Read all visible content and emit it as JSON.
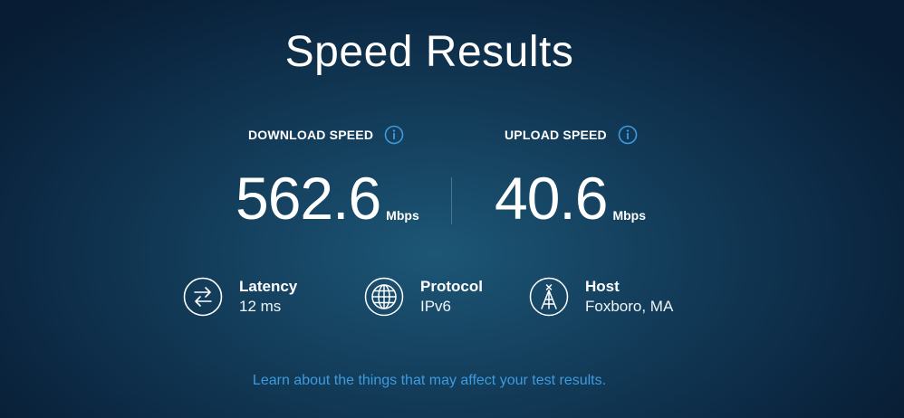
{
  "page": {
    "title": "Speed Results"
  },
  "download": {
    "label": "DOWNLOAD SPEED",
    "value": "562.6",
    "unit": "Mbps"
  },
  "upload": {
    "label": "UPLOAD SPEED",
    "value": "40.6",
    "unit": "Mbps"
  },
  "stats": {
    "latency": {
      "title": "Latency",
      "value": "12 ms",
      "icon": "arrows-exchange-icon"
    },
    "protocol": {
      "title": "Protocol",
      "value": "IPv6",
      "icon": "globe-icon"
    },
    "host": {
      "title": "Host",
      "value": "Foxboro, MA",
      "icon": "tower-icon"
    }
  },
  "footer": {
    "link_text": "Learn about the things that may affect your test results."
  },
  "colors": {
    "accent": "#3d9be0",
    "text": "#ffffff",
    "divider": "#4a7490"
  }
}
